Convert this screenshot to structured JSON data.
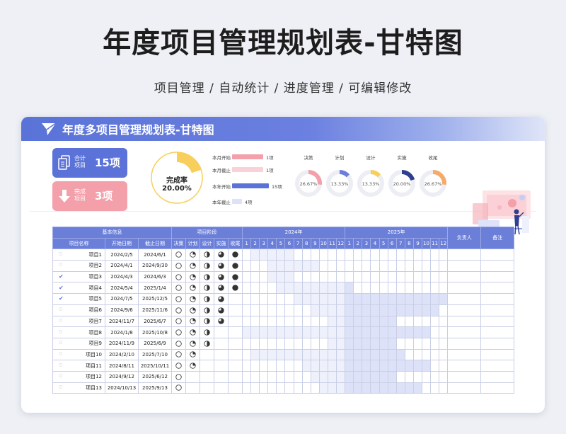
{
  "page": {
    "title": "年度项目管理规划表-甘特图",
    "subtitle": "项目管理 / 自动统计 / 进度管理 / 可编辑修改"
  },
  "banner": {
    "title": "年度多项目管理规划表-甘特图",
    "logo": "paper-plane-icon"
  },
  "summary": {
    "total": {
      "label1": "合计",
      "label2": "项目",
      "value": "15项",
      "icon": "document-icon"
    },
    "done": {
      "label1": "完成",
      "label2": "项目",
      "value": "3项",
      "icon": "arrow-down-icon"
    },
    "completion": {
      "label": "完成率",
      "value": "20.00%",
      "fraction": 0.2
    },
    "bars": [
      {
        "label": "本月开始",
        "value": "1项",
        "count": 1,
        "color": "#f3a0ab"
      },
      {
        "label": "本月截止",
        "value": "1项",
        "count": 1,
        "color": "#f8d2d6"
      },
      {
        "label": "本年开始",
        "value": "15项",
        "count": 15,
        "color": "#5b73d9"
      },
      {
        "label": "本年截止",
        "value": "4项",
        "count": 4,
        "color": "#dde2f8"
      }
    ],
    "donuts": [
      {
        "label": "决策",
        "value": "26.67%",
        "fraction": 0.2667,
        "color": "#f3a0ab"
      },
      {
        "label": "计划",
        "value": "13.33%",
        "fraction": 0.1333,
        "color": "#6b7fd9"
      },
      {
        "label": "设计",
        "value": "13.33%",
        "fraction": 0.1333,
        "color": "#f7cf5a"
      },
      {
        "label": "实施",
        "value": "20.00%",
        "fraction": 0.2,
        "color": "#2f3f8f"
      },
      {
        "label": "收尾",
        "value": "26.67%",
        "fraction": 0.2667,
        "color": "#f5a96b"
      }
    ]
  },
  "table": {
    "group_headers": {
      "basic": "基本信息",
      "phase": "项目阶段",
      "year1": "2024年",
      "year2": "2025年",
      "owner": "负责人",
      "note": "备注"
    },
    "columns": {
      "name": "项目名称",
      "start": "开始日期",
      "end": "截止日期",
      "phases": [
        "决策",
        "计划",
        "设计",
        "实施",
        "收尾"
      ]
    },
    "months": [
      "1",
      "2",
      "3",
      "4",
      "5",
      "6",
      "7",
      "8",
      "9",
      "10",
      "11",
      "12",
      "1",
      "2",
      "3",
      "4",
      "5",
      "6",
      "7",
      "8",
      "9",
      "10",
      "11",
      "12"
    ],
    "rows": [
      {
        "done": false,
        "name": "项目1",
        "start": "2024/2/5",
        "end": "2024/6/1",
        "phases": [
          1,
          2,
          3,
          4,
          5
        ],
        "gantt": [
          0,
          1,
          1,
          1,
          1,
          1,
          0,
          0,
          0,
          0,
          0,
          0,
          0,
          0,
          0,
          0,
          0,
          0,
          0,
          0,
          0,
          0,
          0,
          0
        ]
      },
      {
        "done": false,
        "name": "项目2",
        "start": "2024/4/1",
        "end": "2024/9/30",
        "phases": [
          1,
          2,
          3,
          4,
          5
        ],
        "gantt": [
          0,
          0,
          0,
          1,
          1,
          1,
          1,
          1,
          1,
          0,
          0,
          0,
          0,
          0,
          0,
          0,
          0,
          0,
          0,
          0,
          0,
          0,
          0,
          0
        ]
      },
      {
        "done": true,
        "name": "项目3",
        "start": "2024/4/3",
        "end": "2024/6/3",
        "phases": [
          1,
          2,
          3,
          4,
          5
        ],
        "gantt": [
          0,
          0,
          0,
          1,
          1,
          1,
          0,
          0,
          0,
          0,
          0,
          0,
          0,
          0,
          0,
          0,
          0,
          0,
          0,
          0,
          0,
          0,
          0,
          0
        ]
      },
      {
        "done": true,
        "name": "项目4",
        "start": "2024/5/4",
        "end": "2025/1/4",
        "phases": [
          1,
          2,
          3,
          4,
          5
        ],
        "gantt": [
          0,
          0,
          0,
          0,
          1,
          1,
          1,
          1,
          1,
          1,
          1,
          1,
          2,
          0,
          0,
          0,
          0,
          0,
          0,
          0,
          0,
          0,
          0,
          0
        ]
      },
      {
        "done": true,
        "name": "项目5",
        "start": "2024/7/5",
        "end": "2025/12/5",
        "phases": [
          1,
          2,
          3,
          4,
          0
        ],
        "gantt": [
          0,
          0,
          0,
          0,
          0,
          0,
          1,
          1,
          1,
          1,
          1,
          1,
          2,
          2,
          2,
          2,
          2,
          2,
          2,
          2,
          2,
          2,
          2,
          2
        ]
      },
      {
        "done": false,
        "name": "项目6",
        "start": "2024/9/6",
        "end": "2025/11/6",
        "phases": [
          1,
          2,
          3,
          4,
          0
        ],
        "gantt": [
          0,
          0,
          0,
          0,
          0,
          0,
          0,
          0,
          1,
          1,
          1,
          1,
          2,
          2,
          2,
          2,
          2,
          2,
          2,
          2,
          2,
          2,
          2,
          0
        ]
      },
      {
        "done": false,
        "name": "项目7",
        "start": "2024/11/7",
        "end": "2025/6/7",
        "phases": [
          1,
          2,
          3,
          4,
          0
        ],
        "gantt": [
          0,
          0,
          0,
          0,
          0,
          0,
          0,
          0,
          0,
          0,
          1,
          1,
          2,
          2,
          2,
          2,
          2,
          2,
          0,
          0,
          0,
          0,
          0,
          0
        ]
      },
      {
        "done": false,
        "name": "项目8",
        "start": "2024/1/8",
        "end": "2025/10/8",
        "phases": [
          1,
          2,
          3,
          0,
          0
        ],
        "gantt": [
          1,
          1,
          1,
          1,
          1,
          1,
          1,
          1,
          1,
          1,
          1,
          1,
          2,
          2,
          2,
          2,
          2,
          2,
          2,
          2,
          2,
          2,
          0,
          0
        ]
      },
      {
        "done": false,
        "name": "项目9",
        "start": "2024/11/9",
        "end": "2025/6/9",
        "phases": [
          1,
          2,
          3,
          0,
          0
        ],
        "gantt": [
          0,
          0,
          0,
          0,
          0,
          0,
          0,
          0,
          0,
          0,
          1,
          1,
          2,
          2,
          2,
          2,
          2,
          2,
          0,
          0,
          0,
          0,
          0,
          0
        ]
      },
      {
        "done": false,
        "name": "项目10",
        "start": "2024/2/10",
        "end": "2025/7/10",
        "phases": [
          1,
          2,
          0,
          0,
          0
        ],
        "gantt": [
          0,
          1,
          1,
          1,
          1,
          1,
          1,
          1,
          1,
          1,
          1,
          1,
          2,
          2,
          2,
          2,
          2,
          2,
          2,
          0,
          0,
          0,
          0,
          0
        ]
      },
      {
        "done": false,
        "name": "项目11",
        "start": "2024/8/11",
        "end": "2025/10/11",
        "phases": [
          1,
          2,
          0,
          0,
          0
        ],
        "gantt": [
          0,
          0,
          0,
          0,
          0,
          0,
          0,
          1,
          1,
          1,
          1,
          1,
          2,
          2,
          2,
          2,
          2,
          2,
          2,
          2,
          2,
          2,
          0,
          0
        ]
      },
      {
        "done": false,
        "name": "项目12",
        "start": "2024/9/12",
        "end": "2025/6/12",
        "phases": [
          1,
          0,
          0,
          0,
          0
        ],
        "gantt": [
          0,
          0,
          0,
          0,
          0,
          0,
          0,
          0,
          1,
          1,
          1,
          1,
          2,
          2,
          2,
          2,
          2,
          2,
          0,
          0,
          0,
          0,
          0,
          0
        ]
      },
      {
        "done": false,
        "name": "项目13",
        "start": "2024/10/13",
        "end": "2025/9/13",
        "phases": [
          1,
          0,
          0,
          0,
          0
        ],
        "gantt": [
          0,
          0,
          0,
          0,
          0,
          0,
          0,
          0,
          0,
          1,
          1,
          1,
          2,
          2,
          2,
          2,
          2,
          2,
          2,
          2,
          2,
          0,
          0,
          0
        ]
      }
    ]
  }
}
